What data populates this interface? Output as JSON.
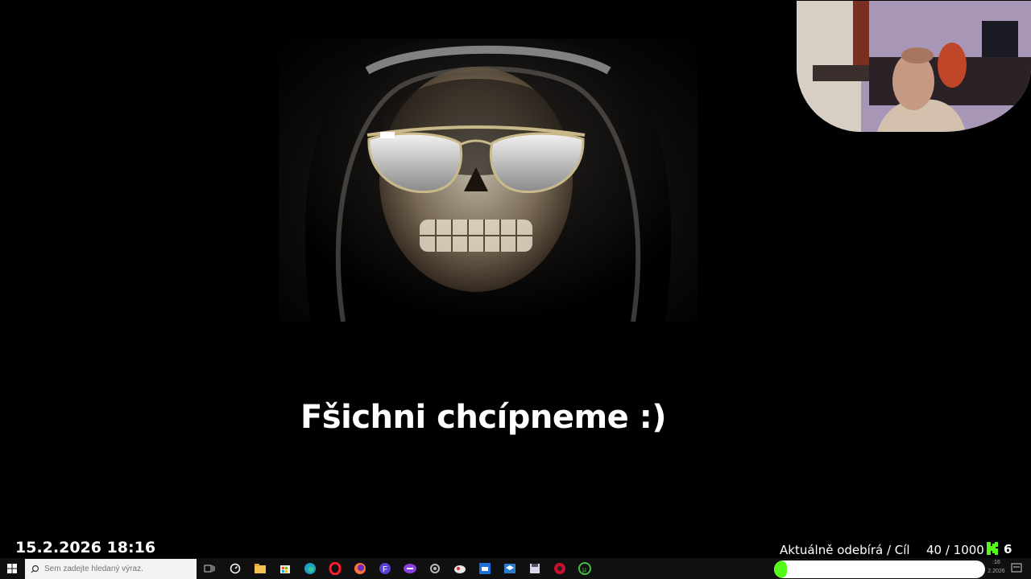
{
  "caption": "Fšichni chcípneme :)",
  "overlay": {
    "datetime": "15.2.2026 18:16",
    "sub_goal_label": "Aktuálně odebírá / Cíl",
    "sub_goal_count": "40 / 1000",
    "sub_goal_progress": 0.04,
    "kick_count": "6",
    "kick_color": "#53fc18"
  },
  "taskbar": {
    "search_placeholder": "Sem zadejte hledaný výraz.",
    "clock_line1": ":16",
    "clock_line2": "2.2026",
    "apps": [
      "task-view-icon",
      "clock-app-icon",
      "file-explorer-icon",
      "store-icon",
      "edge-icon",
      "opera-icon",
      "firefox-icon",
      "app-f-icon",
      "vpn-icon",
      "settings-icon",
      "cloud-app-icon",
      "mail-app-icon",
      "virtualbox-icon",
      "save-app-icon",
      "obs-icon",
      "utorrent-icon"
    ]
  }
}
